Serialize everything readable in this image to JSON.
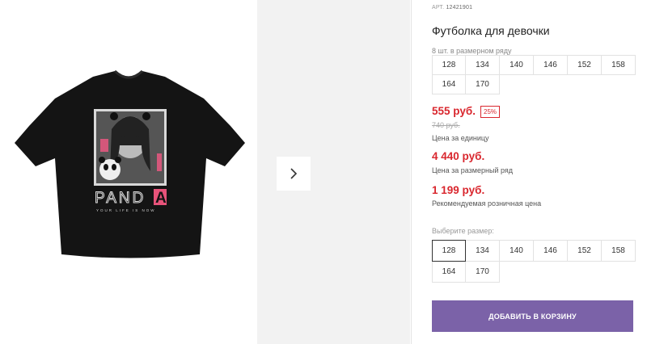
{
  "product": {
    "article_label": "АРТ.",
    "article_number": "12421901",
    "title": "Футболка для девочки",
    "print_text_main": "PAND",
    "print_text_accent": "A",
    "print_tagline": "YOUR LIFE IS NOW"
  },
  "pack": {
    "note": "8 шт. в размерном ряду",
    "sizes": [
      "128",
      "134",
      "140",
      "146",
      "152",
      "158",
      "164",
      "170"
    ]
  },
  "prices": {
    "unit_price": "555 руб.",
    "discount": "25%",
    "old_price": "740 руб.",
    "unit_label": "Цена за единицу",
    "pack_price": "4 440 руб.",
    "pack_label": "Цена за размерный ряд",
    "retail_price": "1 199 руб.",
    "retail_label": "Рекомендуемая розничная цена"
  },
  "size_select": {
    "label": "Выберите размер:",
    "selected": "128",
    "sizes": [
      "128",
      "134",
      "140",
      "146",
      "152",
      "158",
      "164",
      "170"
    ]
  },
  "actions": {
    "add_to_cart": "ДОБАВИТЬ В КОРЗИНУ"
  },
  "colors": {
    "accent_red": "#d9272e",
    "button_purple": "#7b62a8",
    "print_pink": "#e8537a"
  }
}
